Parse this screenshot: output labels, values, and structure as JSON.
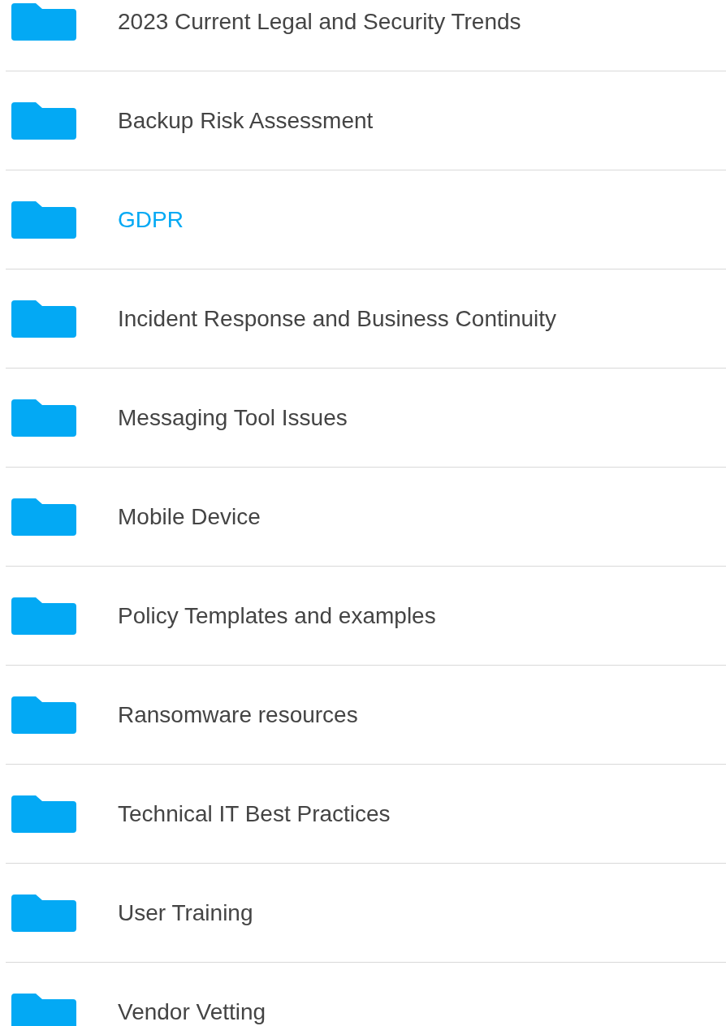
{
  "folders": [
    {
      "name": "2023 Current Legal and Security Trends",
      "selected": false
    },
    {
      "name": "Backup Risk Assessment",
      "selected": false
    },
    {
      "name": "GDPR",
      "selected": true
    },
    {
      "name": "Incident Response and Business Continuity",
      "selected": false
    },
    {
      "name": "Messaging Tool Issues",
      "selected": false
    },
    {
      "name": "Mobile Device",
      "selected": false
    },
    {
      "name": "Policy Templates and examples",
      "selected": false
    },
    {
      "name": "Ransomware resources",
      "selected": false
    },
    {
      "name": "Technical IT Best Practices",
      "selected": false
    },
    {
      "name": "User Training",
      "selected": false
    },
    {
      "name": "Vendor Vetting",
      "selected": false
    }
  ]
}
